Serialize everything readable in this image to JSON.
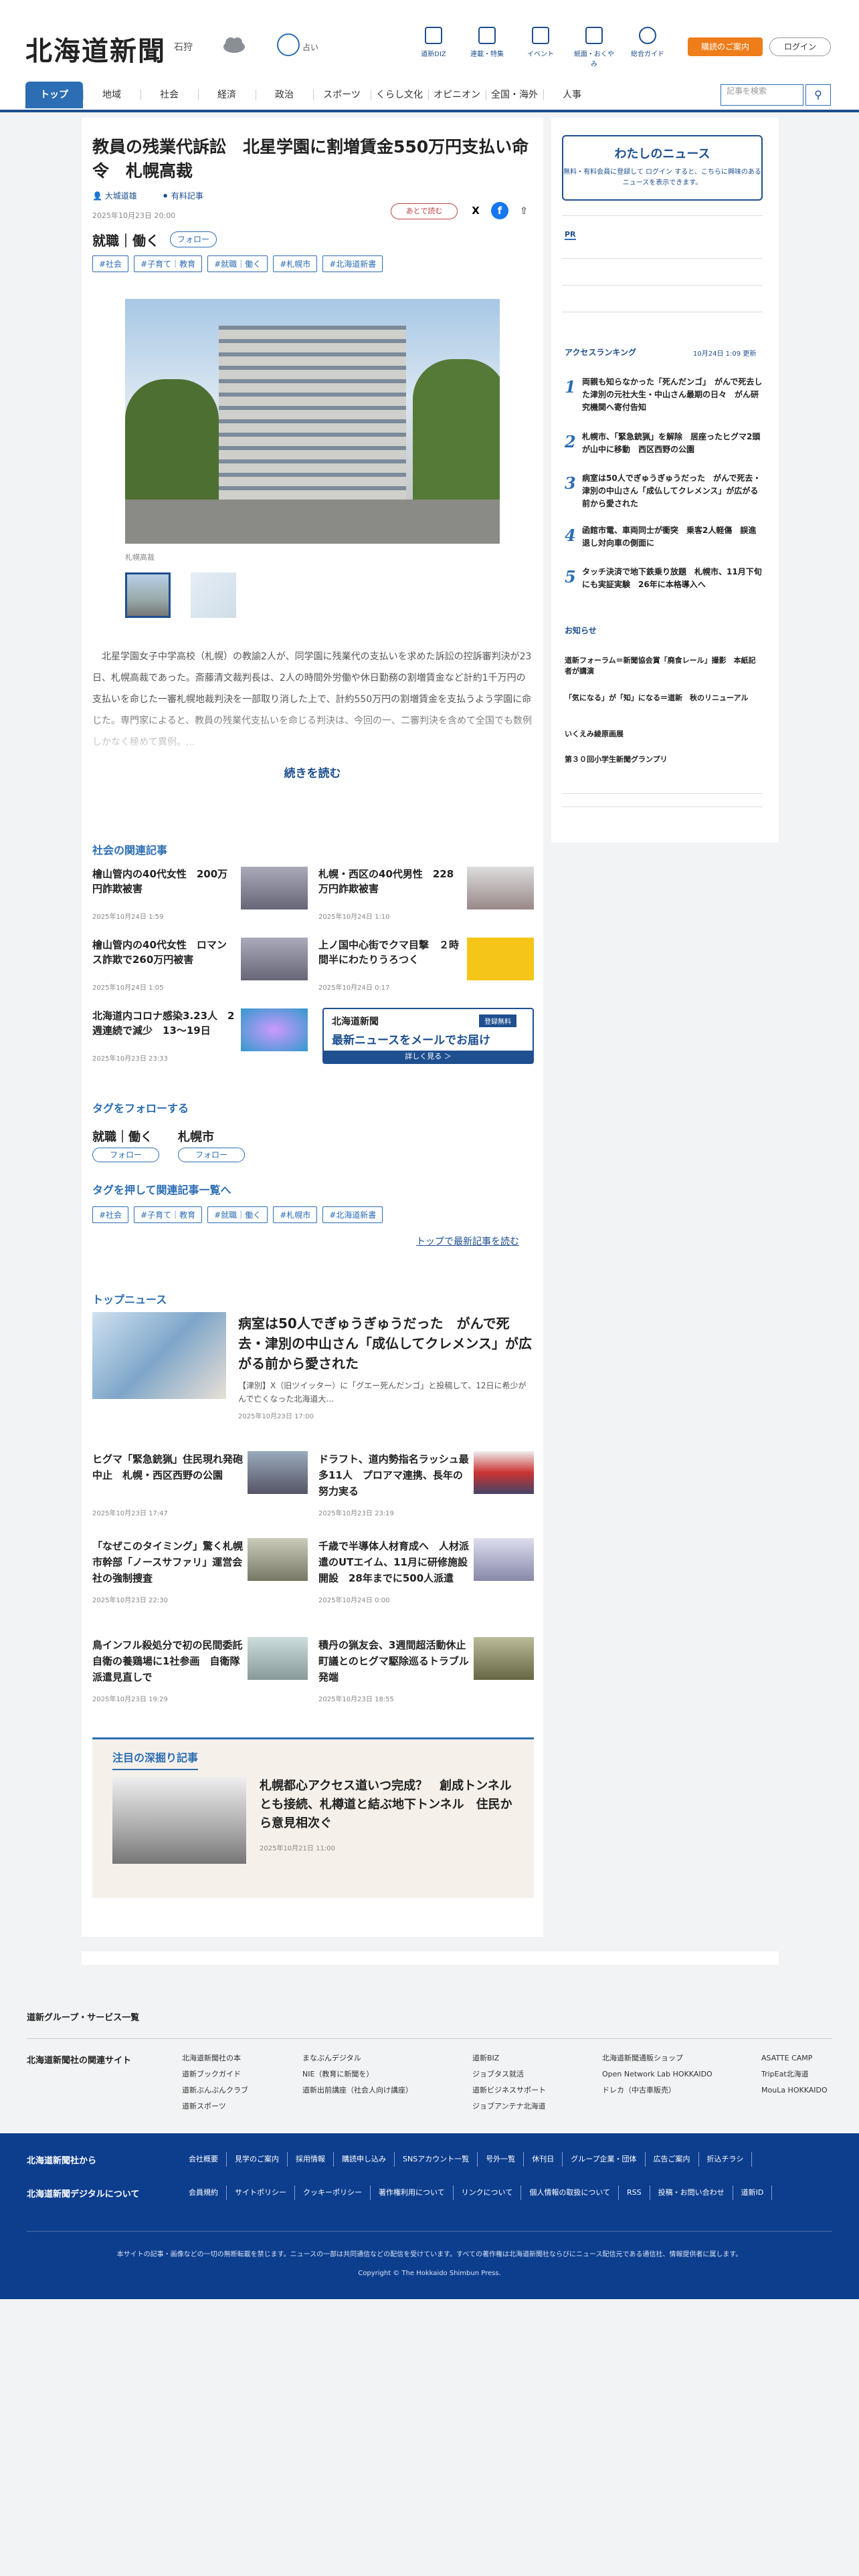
{
  "header": {
    "logo": "北海道新聞",
    "area": "石狩",
    "temp_label": "占い",
    "icons": [
      {
        "label": "道新DIZ",
        "icon": "book-icon"
      },
      {
        "label": "連載・特集",
        "icon": "flag-icon"
      },
      {
        "label": "イベント",
        "icon": "calendar-icon"
      },
      {
        "label": "紙面・おくやみ",
        "icon": "newspaper-icon"
      },
      {
        "label": "総合ガイド",
        "icon": "help-icon"
      }
    ],
    "subscribe_label": "購読のご案内",
    "login_label": "ログイン",
    "search_placeholder": "記事を検索"
  },
  "nav": [
    "トップ",
    "地域",
    "社会",
    "経済",
    "政治",
    "スポーツ",
    "くらし文化",
    "オピニオン",
    "全国・海外",
    "人事"
  ],
  "article": {
    "title": "教員の残業代訴訟　北星学園に割増賃金550万円支払い命令　札幌高裁",
    "author": "大城道雄",
    "author_note": "有料記事",
    "date": "2025年10月23日 20:00",
    "save_label": "あとで読む",
    "main_tag": "就職｜働く",
    "follow_label": "フォロー",
    "tags": [
      "#社会",
      "#子育て｜教育",
      "#就職｜働く",
      "#札幌市",
      "#北海道新書"
    ],
    "photo_caption": "札幌高裁",
    "body": "　北星学園女子中学高校（札幌）の教諭2人が、同学園に残業代の支払いを求めた訴訟の控訴審判決が23日、札幌高裁であった。斎藤清文裁判長は、2人の時間外労働や休日勤務の割増賃金など計約1千万円の支払いを命じた一審札幌地裁判決を一部取り消した上で、計約550万円の割増賃金を支払うよう学園に命じた。専門家によると、教員の残業代支払いを命じる判決は、今回の一、二審判決を含めて全国でも数例しかなく極めて異例。...",
    "read_more": "続きを読む"
  },
  "related": {
    "heading": "社会の関連記事",
    "items": [
      {
        "title": "檜山管内の40代女性　200万円詐欺被害",
        "date": "2025年10月24日 1:59"
      },
      {
        "title": "札幌・西区の40代男性　228万円詐欺被害",
        "date": "2025年10月24日 1:10"
      },
      {
        "title": "檜山管内の40代女性　ロマンス詐欺で260万円被害",
        "date": "2025年10月24日 1:05"
      },
      {
        "title": "上ノ国中心街でクマ目撃　２時間半にわたりうろつく",
        "date": "2025年10月24日 0:17"
      },
      {
        "title": "北海道内コロナ感染3.23人　2週連続で減少　13～19日",
        "date": "2025年10月23日 23:33"
      }
    ],
    "banner_logo": "北海道新聞",
    "banner_badge": "登録無料",
    "banner_title": "最新ニュースをメールでお届け",
    "banner_link": "詳しく見る ＞"
  },
  "tag_follow": {
    "heading": "タグをフォローする",
    "items": [
      {
        "name": "就職｜働く",
        "button": "フォロー"
      },
      {
        "name": "札幌市",
        "button": "フォロー"
      }
    ]
  },
  "tag_list": {
    "heading": "タグを押して関連記事一覧へ",
    "tags": [
      "#社会",
      "#子育て｜教育",
      "#就職｜働く",
      "#札幌市",
      "#北海道新書"
    ],
    "top_link": "トップで最新記事を読む"
  },
  "top_news": {
    "heading": "トップニュース",
    "main_title": "病室は50人でぎゅうぎゅうだった　がんで死去・津別の中山さん「成仏してクレメンス」が広がる前から愛された",
    "main_summary": "【津別】X（旧ツイッター）に「グエー死んだンゴ」と投稿して、12日に希少がんで亡くなった北海道大...",
    "main_date": "2025年10月23日 17:00",
    "items": [
      {
        "title": "ヒグマ「緊急銃猟」住民現れ発砲中止　札幌・西区西野の公園",
        "date": "2025年10月23日 17:47"
      },
      {
        "title": "ドラフト、道内勢指名ラッシュ最多11人　プロアマ連携、長年の努力実る",
        "date": "2025年10月23日 23:19"
      },
      {
        "title": "「なぜこのタイミング」驚く札幌市幹部「ノースサファリ」運営会社の強制捜査",
        "date": "2025年10月23日 22:30"
      },
      {
        "title": "千歳で半導体人材育成へ　人材派遣のUTエイム、11月に研修施設開設　28年までに500人派遣",
        "date": "2025年10月24日 0:00"
      },
      {
        "title": "鳥インフル殺処分で初の民間委託　自衛の養鶏場に1社参画　自衛隊派遣見直しで",
        "date": "2025年10月23日 19:29"
      },
      {
        "title": "積丹の猟友会、3週間超活動休止　町議とのヒグマ駆除巡るトラブル発端",
        "date": "2025年10月23日 18:55"
      }
    ]
  },
  "deep": {
    "heading": "注目の深掘り記事",
    "title": "札幌都心アクセス道いつ完成？　創成トンネルとも接続、札樽道と結ぶ地下トンネル　住民から意見相次ぐ",
    "date": "2025年10月21日 11:00"
  },
  "sidebar": {
    "mynews_title": "わたしのニュース",
    "mynews_text": "無料・有料会員に登録して ログイン すると、こちらに興味のあるニュースを表示できます。",
    "pr_label": "PR",
    "ranking_title": "アクセスランキング",
    "ranking_updated": "10月24日 1:09 更新",
    "ranking": [
      {
        "rank": "1",
        "title": "両親も知らなかった「死んだンゴ」　がんで死去した津別の元社大生・中山さん最期の日々　がん研究機関へ寄付告知"
      },
      {
        "rank": "2",
        "title": "札幌市、「緊急銃猟」を解除　居座ったヒグマ2頭が山中に移動　西区西野の公園"
      },
      {
        "rank": "3",
        "title": "病室は50人でぎゅうぎゅうだった　がんで死去・津別の中山さん「成仏してクレメンス」が広がる前から愛された"
      },
      {
        "rank": "4",
        "title": "函館市電、車両同士が衝突　乗客2人軽傷　誤進退し対向車の側面に"
      },
      {
        "rank": "5",
        "title": "タッチ決済で地下鉄乗り放題　札幌市、11月下旬にも実証実験　26年に本格導入へ"
      }
    ],
    "notice_title": "お知らせ",
    "notices": [
      "道新フォーラム＝新聞協会賞「廃食レール」撮影　本紙記者が講演",
      "「気になる」が「知」になる＝道新　秋のリニューアル",
      "いくえみ綾原画展",
      "第３０回小学生新聞グランプリ"
    ]
  },
  "footer": {
    "group_label": "道新グループ・サービス一覧",
    "related_sites_label": "北海道新聞社の関連サイト",
    "sites_col1": [
      "北海道新聞社の本",
      "道新ブックガイド",
      "道新ぶんぶんクラブ",
      "道新スポーツ"
    ],
    "sites_col2": [
      "まなぶんデジタル",
      "NIE（教育に新聞を）",
      "道新出前講座（社会人向け講座）"
    ],
    "sites_col3": [
      "道新BIZ",
      "ジョブタス就活",
      "道新ビジネスサポート",
      "ジョブアンテナ北海道"
    ],
    "sites_col4": [
      "北海道新聞通販ショップ",
      "Open Network Lab HOKKAIDO",
      "ドレカ（中古車販売）"
    ],
    "sites_col5": [
      "ASATTE CAMP",
      "TripEat北海道",
      "MouLa HOKKAIDO"
    ],
    "company_heading": "北海道新聞社から",
    "company_links": [
      "会社概要",
      "見学のご案内",
      "採用情報",
      "購読申し込み",
      "SNSアカウント一覧",
      "号外一覧",
      "休刊日",
      "グループ企業・団体",
      "広告ご案内",
      "折込チラシ"
    ],
    "digital_heading": "北海道新聞デジタルについて",
    "digital_links": [
      "会員規約",
      "サイトポリシー",
      "クッキーポリシー",
      "著作権利用について",
      "リンクについて",
      "個人情報の取扱について",
      "RSS",
      "投稿・お問い合わせ",
      "道新ID"
    ],
    "note": "本サイトの記事・画像などの一切の無断転載を禁じます。ニュースの一部は共同通信などの配信を受けています。すべての著作権は北海道新聞社ならびにニュース配信元である通信社、情報提供者に属します。",
    "copyright": "Copyright © The Hokkaido Shimbun Press."
  }
}
